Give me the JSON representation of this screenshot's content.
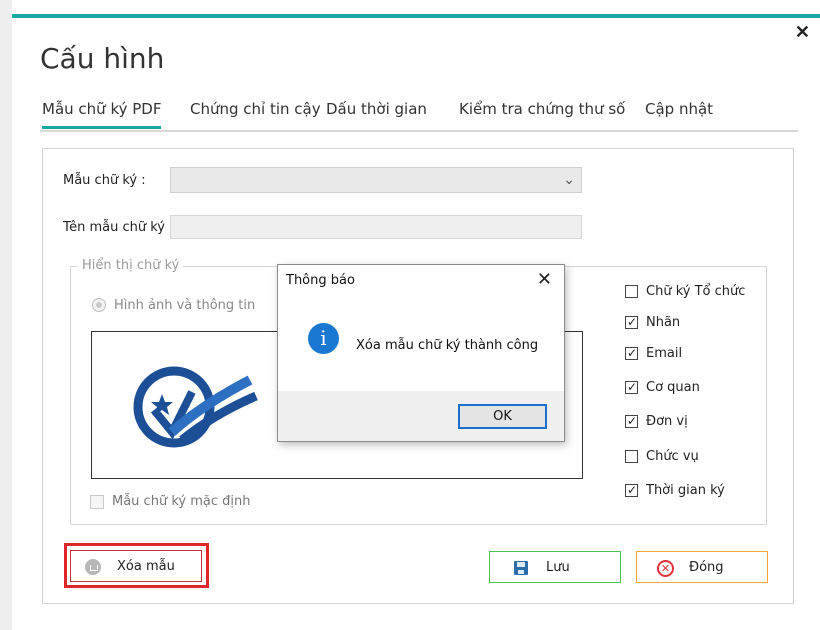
{
  "window": {
    "title": "Cấu hình",
    "close_glyph": "✕"
  },
  "tabs": [
    {
      "label": "Mẫu chữ ký PDF",
      "active": true
    },
    {
      "label": "Chứng chỉ tin cậy",
      "active": false
    },
    {
      "label": "Dấu thời gian",
      "active": false
    },
    {
      "label": "Kiểm tra chứng thư số",
      "active": false
    },
    {
      "label": "Cập nhật",
      "active": false
    }
  ],
  "form": {
    "template_label": "Mẫu chữ ký :",
    "template_value": "",
    "name_label": "Tên mẫu chữ ký :",
    "name_value": ""
  },
  "display_group": {
    "legend": "Hiển thị chữ ký",
    "radio_label": "Hình ảnh và thông tin",
    "default_label": "Mẫu chữ ký mặc định",
    "default_checked": false
  },
  "options": [
    {
      "label": "Chữ ký Tổ chức",
      "checked": false
    },
    {
      "label": "Nhãn",
      "checked": true
    },
    {
      "label": "Email",
      "checked": true
    },
    {
      "label": "Cơ quan",
      "checked": true
    },
    {
      "label": "Đơn vị",
      "checked": true
    },
    {
      "label": "Chức vụ",
      "checked": false
    },
    {
      "label": "Thời gian ký",
      "checked": true
    }
  ],
  "buttons": {
    "delete_label": "Xóa mẫu",
    "save_label": "Lưu",
    "close_label": "Đóng"
  },
  "message_box": {
    "title": "Thông báo",
    "text": "Xóa mẫu chữ ký thành công",
    "ok_label": "OK",
    "icon": "info-icon"
  },
  "colors": {
    "accent": "#17a9a0",
    "delete_border": "#e0262c",
    "save_border": "#4fbf59",
    "close_border": "#eda93a",
    "info_blue": "#1a78d2"
  }
}
